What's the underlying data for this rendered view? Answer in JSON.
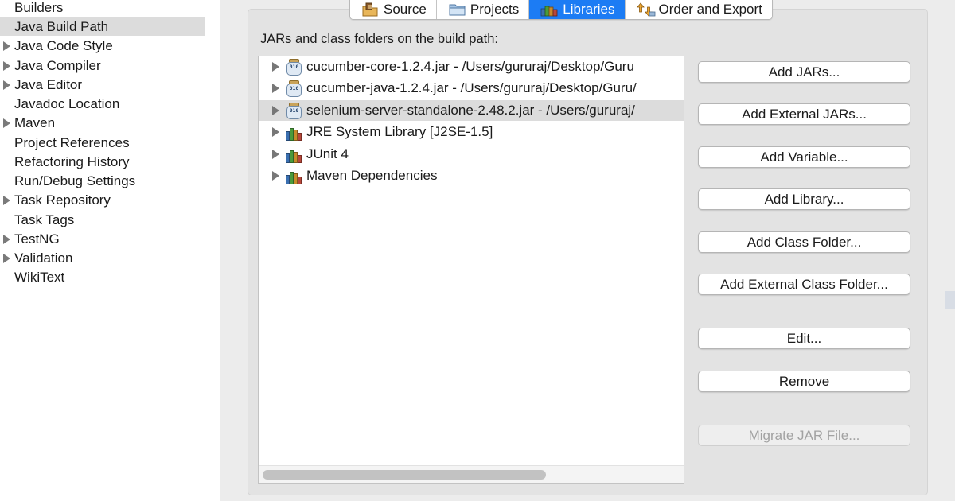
{
  "sidebar": {
    "items": [
      {
        "label": "Builders",
        "expandable": false,
        "selected": false
      },
      {
        "label": "Java Build Path",
        "expandable": false,
        "selected": true
      },
      {
        "label": "Java Code Style",
        "expandable": true,
        "selected": false
      },
      {
        "label": "Java Compiler",
        "expandable": true,
        "selected": false
      },
      {
        "label": "Java Editor",
        "expandable": true,
        "selected": false
      },
      {
        "label": "Javadoc Location",
        "expandable": false,
        "selected": false
      },
      {
        "label": "Maven",
        "expandable": true,
        "selected": false
      },
      {
        "label": "Project References",
        "expandable": false,
        "selected": false
      },
      {
        "label": "Refactoring History",
        "expandable": false,
        "selected": false
      },
      {
        "label": "Run/Debug Settings",
        "expandable": false,
        "selected": false
      },
      {
        "label": "Task Repository",
        "expandable": true,
        "selected": false
      },
      {
        "label": "Task Tags",
        "expandable": false,
        "selected": false
      },
      {
        "label": "TestNG",
        "expandable": true,
        "selected": false
      },
      {
        "label": "Validation",
        "expandable": true,
        "selected": false
      },
      {
        "label": "WikiText",
        "expandable": false,
        "selected": false
      }
    ]
  },
  "tabs": [
    {
      "label": "Source",
      "icon": "source-folder-icon",
      "active": false
    },
    {
      "label": "Projects",
      "icon": "projects-folder-icon",
      "active": false
    },
    {
      "label": "Libraries",
      "icon": "libraries-icon",
      "active": true
    },
    {
      "label": "Order and Export",
      "icon": "order-export-icon",
      "active": false
    }
  ],
  "panel": {
    "label": "JARs and class folders on the build path:",
    "tree": [
      {
        "label": "cucumber-core-1.2.4.jar - /Users/gururaj/Desktop/Guru",
        "icon": "jar-icon",
        "selected": false
      },
      {
        "label": "cucumber-java-1.2.4.jar - /Users/gururaj/Desktop/Guru/",
        "icon": "jar-icon",
        "selected": false
      },
      {
        "label": "selenium-server-standalone-2.48.2.jar - /Users/gururaj/",
        "icon": "jar-icon",
        "selected": true
      },
      {
        "label": "JRE System Library [J2SE-1.5]",
        "icon": "library-icon",
        "selected": false
      },
      {
        "label": "JUnit 4",
        "icon": "library-icon",
        "selected": false
      },
      {
        "label": "Maven Dependencies",
        "icon": "library-icon",
        "selected": false
      }
    ],
    "jar_icon_text": "010"
  },
  "buttons": {
    "add_jars": "Add JARs...",
    "add_external_jars": "Add External JARs...",
    "add_variable": "Add Variable...",
    "add_library": "Add Library...",
    "add_class_folder": "Add Class Folder...",
    "add_external_class_folder": "Add External Class Folder...",
    "edit": "Edit...",
    "remove": "Remove",
    "migrate_jar": "Migrate JAR File..."
  },
  "colors": {
    "active_tab": "#1c7cf4",
    "selection": "#dcdcdc",
    "panel_bg": "#e3e3e3"
  }
}
